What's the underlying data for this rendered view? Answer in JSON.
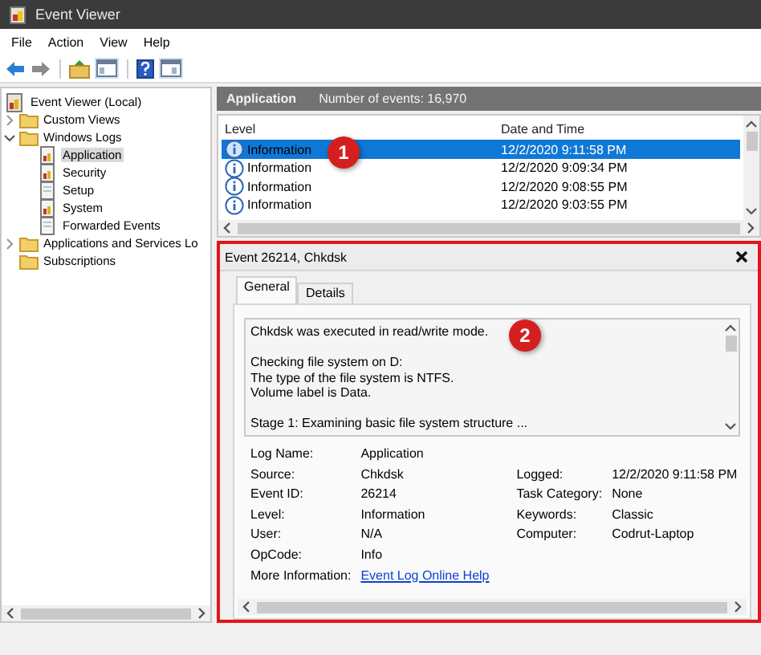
{
  "window": {
    "title": "Event Viewer"
  },
  "menu": [
    {
      "label": "File"
    },
    {
      "label": "Action"
    },
    {
      "label": "View"
    },
    {
      "label": "Help"
    }
  ],
  "tree": [
    {
      "label": "Event Viewer (Local)",
      "kind": "computer",
      "children": [
        {
          "label": "Custom Views",
          "kind": "folder",
          "expanded": false,
          "selected": false
        },
        {
          "label": "Windows Logs",
          "kind": "folder",
          "expanded": true,
          "selected": false,
          "children": [
            {
              "label": "Application",
              "kind": "log",
              "selected": true
            },
            {
              "label": "Security",
              "kind": "log",
              "selected": false
            },
            {
              "label": "Setup",
              "kind": "log-plain",
              "selected": false
            },
            {
              "label": "System",
              "kind": "log",
              "selected": false
            },
            {
              "label": "Forwarded Events",
              "kind": "log-plain",
              "selected": false
            }
          ]
        },
        {
          "label": "Applications and Services Lo",
          "kind": "folder",
          "expanded": false,
          "selected": false
        },
        {
          "label": "Subscriptions",
          "kind": "folder",
          "selected": false
        }
      ]
    }
  ],
  "log_header": {
    "name": "Application",
    "count": "Number of events: 16,970"
  },
  "events": {
    "columns": [
      "Level",
      "Date and Time"
    ],
    "badge": "1",
    "rows": [
      {
        "level": "Information",
        "date": "12/2/2020 9:11:58 PM",
        "selected": true
      },
      {
        "level": "Information",
        "date": "12/2/2020 9:09:34 PM",
        "selected": false
      },
      {
        "level": "Information",
        "date": "12/2/2020 9:08:55 PM",
        "selected": false
      },
      {
        "level": "Information",
        "date": "12/2/2020 9:03:55 PM",
        "selected": false
      }
    ]
  },
  "detail": {
    "title": "Event 26214, Chkdsk",
    "badge": "2",
    "tabs": [
      {
        "label": "General",
        "selected": true
      },
      {
        "label": "Details",
        "selected": false
      }
    ],
    "message": [
      "Chkdsk was executed in read/write mode.",
      "Checking file system on D:\nThe type of the file system is NTFS.\nVolume label is Data.",
      "Stage 1: Examining basic file system structure ..."
    ],
    "rows": [
      {
        "left": {
          "label": "Log Name:",
          "value": "Application"
        }
      },
      {
        "left": {
          "label": "Source:",
          "value": "Chkdsk"
        },
        "right": {
          "label": "Logged:",
          "value": "12/2/2020 9:11:58 PM"
        }
      },
      {
        "left": {
          "label": "Event ID:",
          "value": "26214"
        },
        "right": {
          "label": "Task Category:",
          "value": "None"
        }
      },
      {
        "left": {
          "label": "Level:",
          "value": "Information"
        },
        "right": {
          "label": "Keywords:",
          "value": "Classic"
        }
      },
      {
        "left": {
          "label": "User:",
          "value": "N/A"
        },
        "right": {
          "label": "Computer:",
          "value": "Codrut-Laptop"
        }
      },
      {
        "left": {
          "label": "OpCode:",
          "value": "Info"
        }
      },
      {
        "left": {
          "label": "More Information:",
          "value": "Event Log Online Help",
          "kind": "link"
        }
      }
    ]
  }
}
